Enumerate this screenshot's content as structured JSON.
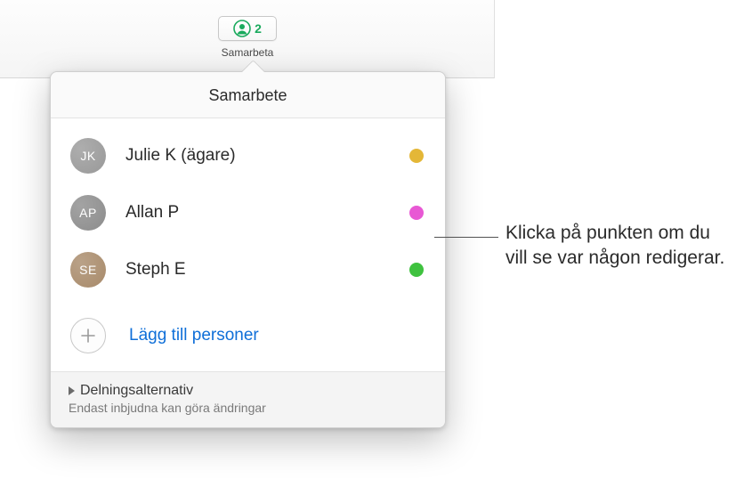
{
  "toolbar": {
    "count": "2",
    "label": "Samarbeta"
  },
  "popover": {
    "title": "Samarbete",
    "people": [
      {
        "initials": "JK",
        "name": "Julie K (ägare)",
        "avatar_bg": "#999999",
        "dot_color": "#e4b737"
      },
      {
        "initials": "AP",
        "name": "Allan P",
        "avatar_bg": "#8c8c8c",
        "dot_color": "#e858d4"
      },
      {
        "initials": "SE",
        "name": "Steph E",
        "avatar_bg": "#a88a6a",
        "dot_color": "#3fc23f"
      }
    ],
    "add_label": "Lägg till personer",
    "footer_title": "Delningsalternativ",
    "footer_sub": "Endast inbjudna kan göra ändringar"
  },
  "callout": {
    "text": "Klicka på punkten om du vill se var någon redigerar."
  }
}
